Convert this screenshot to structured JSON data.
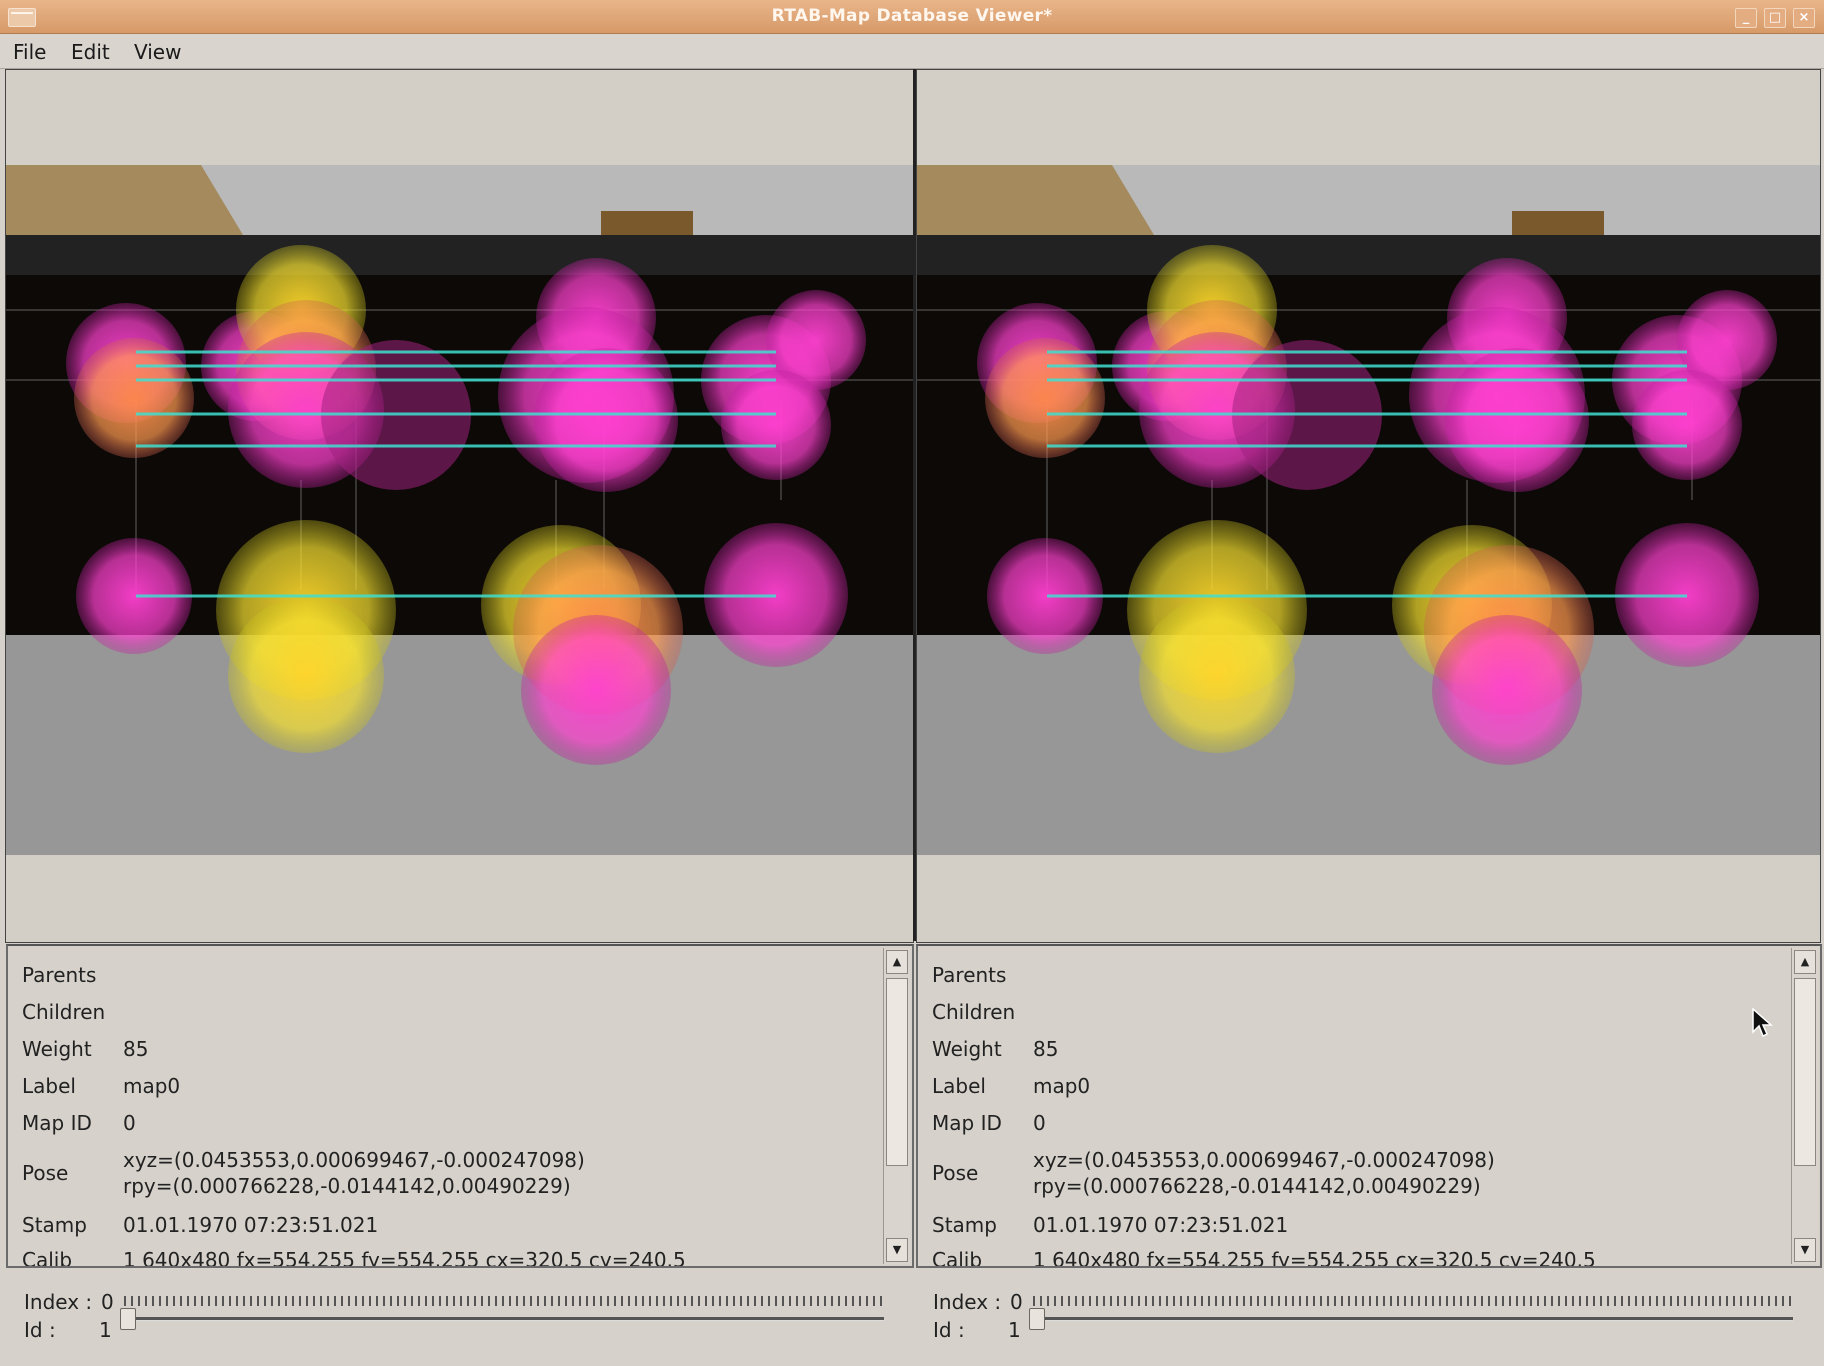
{
  "window": {
    "title": "RTAB-Map Database Viewer*"
  },
  "menu": {
    "file": "File",
    "edit": "Edit",
    "view": "View"
  },
  "colors": {
    "magenta": "#ff3fd8",
    "yellow": "#ffe23a",
    "orange": "#ff9a40",
    "cyan_line": "#3fe0d0",
    "floor": "#979797",
    "wall": "#0d0906",
    "tan": "#a48a5d"
  },
  "left_panel": {
    "info": {
      "parents_label": "Parents",
      "children_label": "Children",
      "weight_label": "Weight",
      "weight_value": "85",
      "label_label": "Label",
      "label_value": "map0",
      "map_id_label": "Map ID",
      "map_id_value": "0",
      "pose_label": "Pose",
      "pose_xyz": "xyz=(0.0453553,0.000699467,-0.000247098)",
      "pose_rpy": "rpy=(0.000766228,-0.0144142,0.00490229)",
      "stamp_label": "Stamp",
      "stamp_value": "01.01.1970 07:23:51.021",
      "calib_label": "Calib",
      "calib_value": "1 640x480 fx=554.255 fy=554.255 cx=320.5 cy=240.5"
    },
    "index_label": "Index :",
    "index_value": "0",
    "id_label": "Id :",
    "id_value": "1"
  },
  "right_panel": {
    "info": {
      "parents_label": "Parents",
      "children_label": "Children",
      "weight_label": "Weight",
      "weight_value": "85",
      "label_label": "Label",
      "label_value": "map0",
      "map_id_label": "Map ID",
      "map_id_value": "0",
      "pose_label": "Pose",
      "pose_xyz": "xyz=(0.0453553,0.000699467,-0.000247098)",
      "pose_rpy": "rpy=(0.000766228,-0.0144142,0.00490229)",
      "stamp_label": "Stamp",
      "stamp_value": "01.01.1970 07:23:51.021",
      "calib_label": "Calib",
      "calib_value": "1 640x480 fx=554.255 fy=554.255 cx=320.5 cy=240.5"
    },
    "index_label": "Index :",
    "index_value": "0",
    "id_label": "Id :",
    "id_value": "1"
  }
}
